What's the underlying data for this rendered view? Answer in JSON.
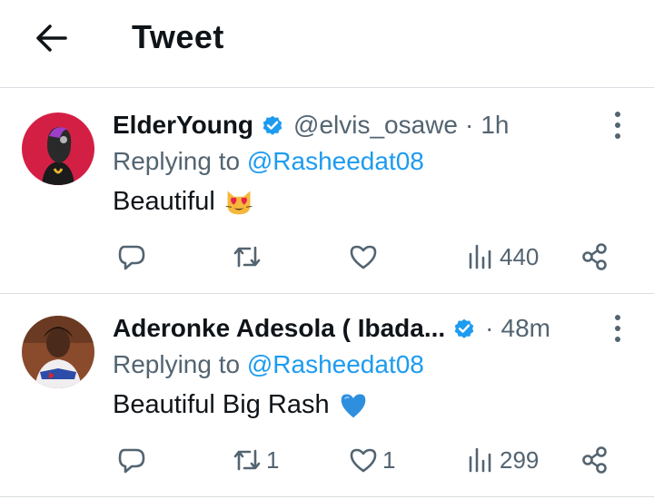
{
  "header": {
    "title": "Tweet",
    "back_icon": "arrow-left-icon"
  },
  "colors": {
    "text": "#0f1419",
    "secondary": "#536471",
    "accent": "#1d9bf0",
    "divider": "#d9dde1"
  },
  "tweets": [
    {
      "display_name": "ElderYoung",
      "verified": true,
      "handle": "@elvis_osawe",
      "separator": "·",
      "time": "1h",
      "replying_prefix": "Replying to",
      "replying_to": "@Rasheedat08",
      "text": "Beautiful",
      "emoji": "heart-eyes-cat-emoji",
      "actions": {
        "reply": "",
        "retweet": "",
        "like": "",
        "views": "440"
      }
    },
    {
      "display_name": "Aderonke Adesola ( Ibada...",
      "verified": true,
      "handle": "",
      "separator": "·",
      "time": "48m",
      "replying_prefix": "Replying to",
      "replying_to": "@Rasheedat08",
      "text": "Beautiful Big Rash",
      "emoji": "blue-heart-emoji",
      "actions": {
        "reply": "",
        "retweet": "1",
        "like": "1",
        "views": "299"
      }
    }
  ]
}
